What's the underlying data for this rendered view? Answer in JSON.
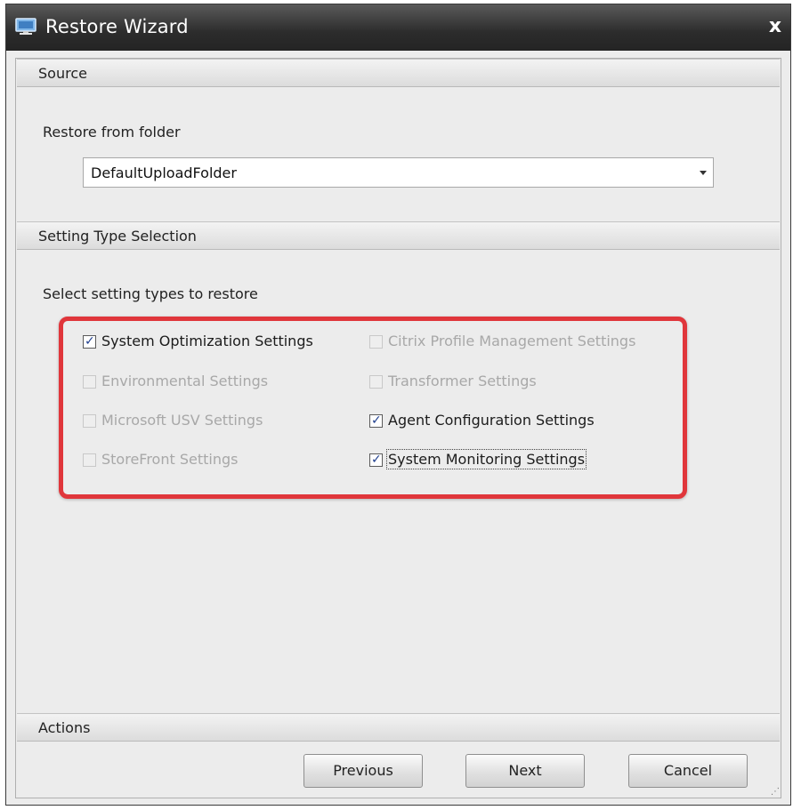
{
  "window": {
    "title": "Restore Wizard",
    "close_label": "x"
  },
  "source": {
    "header": "Source",
    "folder_label": "Restore from folder",
    "folder_value": "DefaultUploadFolder"
  },
  "setting_type": {
    "header": "Setting Type Selection",
    "instruction": "Select setting types to restore",
    "options": [
      {
        "label": "System Optimization Settings",
        "checked": true,
        "enabled": true
      },
      {
        "label": "Citrix Profile Management Settings",
        "checked": false,
        "enabled": false
      },
      {
        "label": "Environmental Settings",
        "checked": false,
        "enabled": false
      },
      {
        "label": "Transformer Settings",
        "checked": false,
        "enabled": false
      },
      {
        "label": "Microsoft USV Settings",
        "checked": false,
        "enabled": false
      },
      {
        "label": "Agent Configuration Settings",
        "checked": true,
        "enabled": true
      },
      {
        "label": "StoreFront Settings",
        "checked": false,
        "enabled": false
      },
      {
        "label": "System Monitoring Settings",
        "checked": true,
        "enabled": true
      }
    ]
  },
  "actions": {
    "header": "Actions",
    "previous_label": "Previous",
    "next_label": "Next",
    "cancel_label": "Cancel"
  },
  "colors": {
    "highlight": "#e0363b",
    "titlebar": "#2c2c2c",
    "checkmark": "#21408f"
  }
}
